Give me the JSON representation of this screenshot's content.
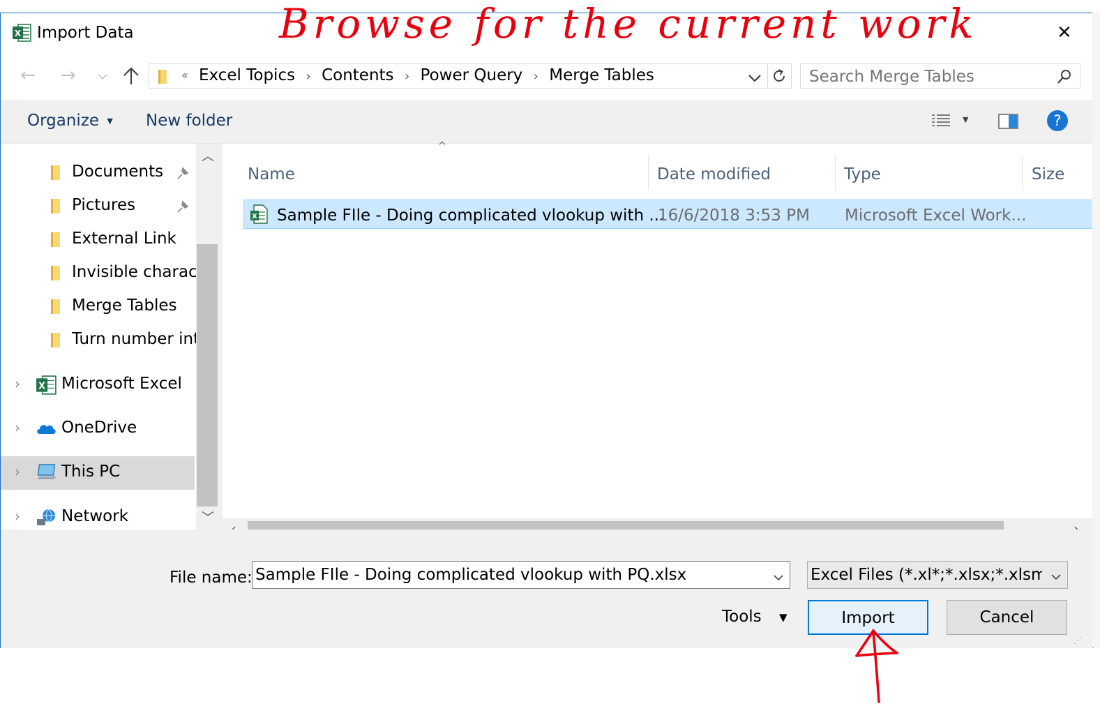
{
  "annotations": {
    "top_note": "Browse for the current work"
  },
  "window": {
    "title": "Import Data",
    "close_glyph": "✕"
  },
  "nav": {
    "breadcrumb_overflow": "«",
    "breadcrumb": [
      "Excel Topics",
      "Contents",
      "Power Query",
      "Merge Tables"
    ],
    "search_placeholder": "Search Merge Tables"
  },
  "toolbar": {
    "organize_label": "Organize",
    "new_folder_label": "New folder",
    "help_glyph": "?"
  },
  "sidebar": {
    "quick_access": [
      {
        "label": "Documents",
        "pinned": true
      },
      {
        "label": "Pictures",
        "pinned": true
      },
      {
        "label": "External Link",
        "pinned": false
      },
      {
        "label": "Invisible characte",
        "pinned": false
      },
      {
        "label": "Merge Tables",
        "pinned": false
      },
      {
        "label": "Turn number int",
        "pinned": false
      }
    ],
    "locations": [
      {
        "label": "Microsoft Excel",
        "icon": "excel-icon"
      },
      {
        "label": "OneDrive",
        "icon": "onedrive-cloud-icon"
      },
      {
        "label": "This PC",
        "icon": "computer-icon",
        "selected": true
      },
      {
        "label": "Network",
        "icon": "network-icon"
      }
    ]
  },
  "file_list": {
    "columns": [
      "Name",
      "Date modified",
      "Type",
      "Size"
    ],
    "rows": [
      {
        "name": "Sample FIle - Doing complicated vlookup with ...",
        "date": "16/6/2018 3:53 PM",
        "type": "Microsoft Excel Work...",
        "selected": true
      }
    ]
  },
  "footer": {
    "file_name_label": "File name:",
    "file_name_value": "Sample FIle - Doing complicated vlookup with PQ.xlsx",
    "file_type_value": "Excel Files (*.xl*;*.xlsx;*.xlsm;*.xls",
    "tools_label": "Tools",
    "import_label": "Import",
    "cancel_label": "Cancel"
  },
  "colors": {
    "accent": "#1e6fbf",
    "selection": "#cce8ff",
    "selection_border": "#99d1ff",
    "annotation_red": "#e8000f",
    "help_blue": "#1874d2"
  }
}
